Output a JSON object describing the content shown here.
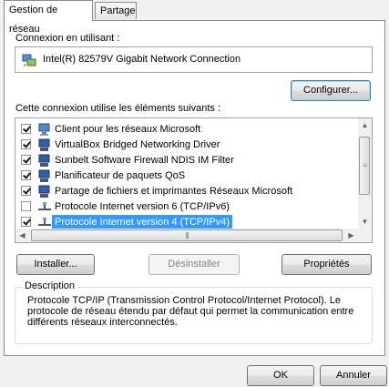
{
  "tabs": [
    {
      "label": "Gestion de réseau",
      "active": true
    },
    {
      "label": "Partage",
      "active": false
    }
  ],
  "connection": {
    "label": "Connexion en utilisant :",
    "adapter_name": "Intel(R) 82579V Gigabit Network Connection",
    "adapter_icon": "network-adapter-icon"
  },
  "buttons": {
    "configure": "Configurer...",
    "install": "Installer...",
    "uninstall": "Désinstaller",
    "properties": "Propriétés",
    "ok": "OK",
    "cancel": "Annuler"
  },
  "items_label": "Cette connexion utilise les éléments suivants :",
  "items": [
    {
      "label": "Client pour les réseaux Microsoft",
      "checked": true,
      "icon": "network-client-icon",
      "selected": false
    },
    {
      "label": "VirtualBox Bridged Networking Driver",
      "checked": true,
      "icon": "network-service-icon",
      "selected": false
    },
    {
      "label": "Sunbelt Software Firewall NDIS IM Filter",
      "checked": true,
      "icon": "network-service-icon",
      "selected": false
    },
    {
      "label": "Planificateur de paquets QoS",
      "checked": true,
      "icon": "network-service-icon",
      "selected": false
    },
    {
      "label": "Partage de fichiers et imprimantes Réseaux Microsoft",
      "checked": true,
      "icon": "network-service-icon",
      "selected": false
    },
    {
      "label": "Protocole Internet version 6 (TCP/IPv6)",
      "checked": false,
      "icon": "network-protocol-icon",
      "selected": false
    },
    {
      "label": "Protocole Internet version 4 (TCP/IPv4)",
      "checked": true,
      "icon": "network-protocol-icon",
      "selected": true
    }
  ],
  "description": {
    "title": "Description",
    "text": "Protocole TCP/IP (Transmission Control Protocol/Internet Protocol). Le protocole de réseau étendu par défaut qui permet la communication entre différents réseaux interconnectés."
  },
  "colors": {
    "selection": "#3399ff",
    "background": "#f0f0f0"
  }
}
